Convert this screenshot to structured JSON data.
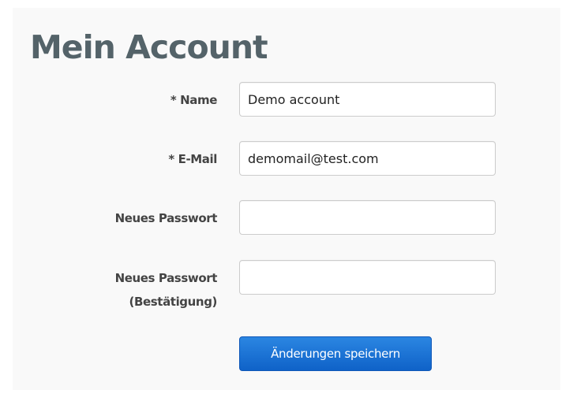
{
  "page": {
    "title": "Mein Account"
  },
  "form": {
    "name": {
      "label": "* Name",
      "value": "Demo account"
    },
    "email": {
      "label": "* E-Mail",
      "value": "demomail@test.com"
    },
    "new_password": {
      "label": "Neues Passwort",
      "value": ""
    },
    "new_password_confirmation": {
      "label_line1": "Neues Passwort",
      "label_line2": "(Bestätigung)",
      "value": ""
    },
    "save_button_label": "Änderungen speichern"
  },
  "colors": {
    "panel_background": "#f9f9f9",
    "title": "#546369",
    "label": "#444444",
    "button": "#1a6fd4"
  }
}
